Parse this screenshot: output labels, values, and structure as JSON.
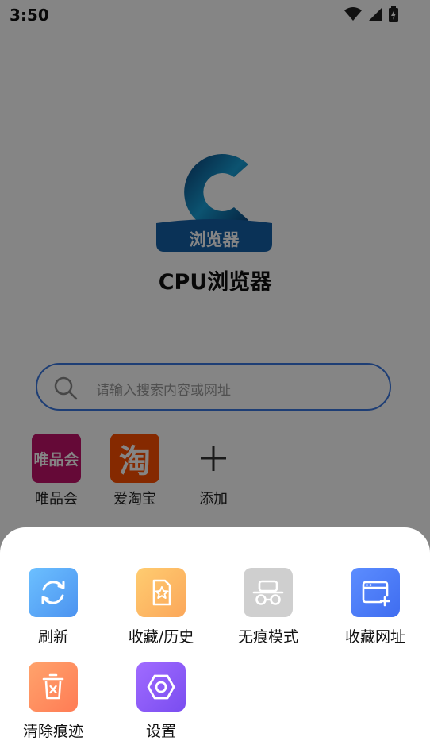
{
  "status_bar": {
    "time": "3:50"
  },
  "app": {
    "name": "CPU浏览器",
    "logo_text": "浏览器"
  },
  "search": {
    "placeholder": "请输入搜索内容或网址"
  },
  "shortcuts": [
    {
      "label": "唯品会",
      "tile_text": "唯品会",
      "color": "#c2126a"
    },
    {
      "label": "爱淘宝",
      "tile_text": "淘",
      "color": "#ff5000"
    },
    {
      "label": "添加"
    }
  ],
  "menu": {
    "items": [
      {
        "label": "刷新",
        "icon": "refresh-icon",
        "color": "#5aa8f7"
      },
      {
        "label": "收藏/历史",
        "icon": "bookmark-star-icon",
        "color": "#fbb565"
      },
      {
        "label": "无痕模式",
        "icon": "incognito-icon",
        "color": "#cfcfcf"
      },
      {
        "label": "收藏网址",
        "icon": "add-bookmark-icon",
        "color": "#4d7df7"
      },
      {
        "label": "清除痕迹",
        "icon": "trash-icon",
        "color": "#ff8a5c"
      },
      {
        "label": "设置",
        "icon": "settings-hex-icon",
        "color": "#8d5cf7"
      }
    ]
  },
  "colors": {
    "accent": "#3a78e0",
    "logo_blue": "#1560a8"
  }
}
